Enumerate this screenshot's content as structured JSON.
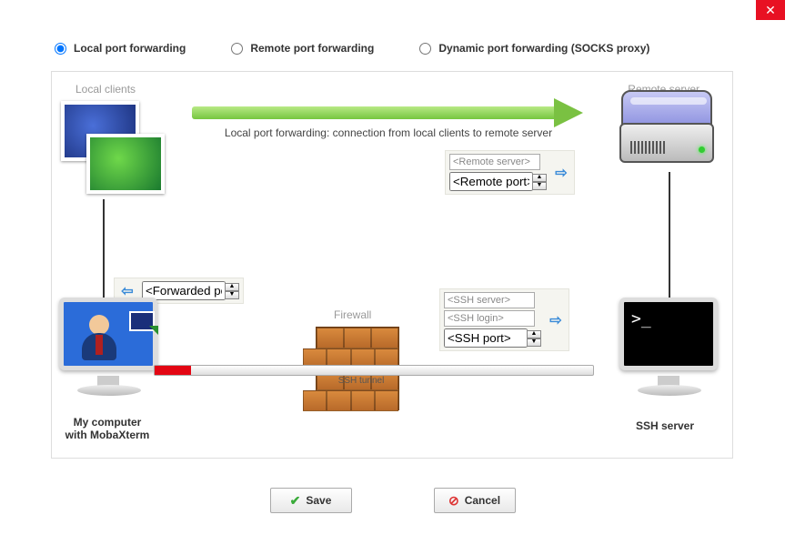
{
  "close_button": "✕",
  "forwarding_types": {
    "local": "Local port forwarding",
    "remote": "Remote port forwarding",
    "dynamic": "Dynamic port forwarding (SOCKS proxy)",
    "selected": "local"
  },
  "labels": {
    "local_clients": "Local clients",
    "remote_server": "Remote server",
    "firewall": "Firewall",
    "ssh_tunnel": "SSH tunnel",
    "my_computer_line1": "My computer",
    "my_computer_line2": "with MobaXterm",
    "ssh_server": "SSH server"
  },
  "arrow_caption": "Local port forwarding: connection from local clients to remote server",
  "fields": {
    "forwarded_port": "<Forwarded port>",
    "remote_server": "<Remote server>",
    "remote_port": "<Remote port>",
    "ssh_server": "<SSH server>",
    "ssh_login": "<SSH login>",
    "ssh_port": "<SSH port>"
  },
  "buttons": {
    "save": "Save",
    "cancel": "Cancel"
  },
  "terminal_prompt": ">_"
}
